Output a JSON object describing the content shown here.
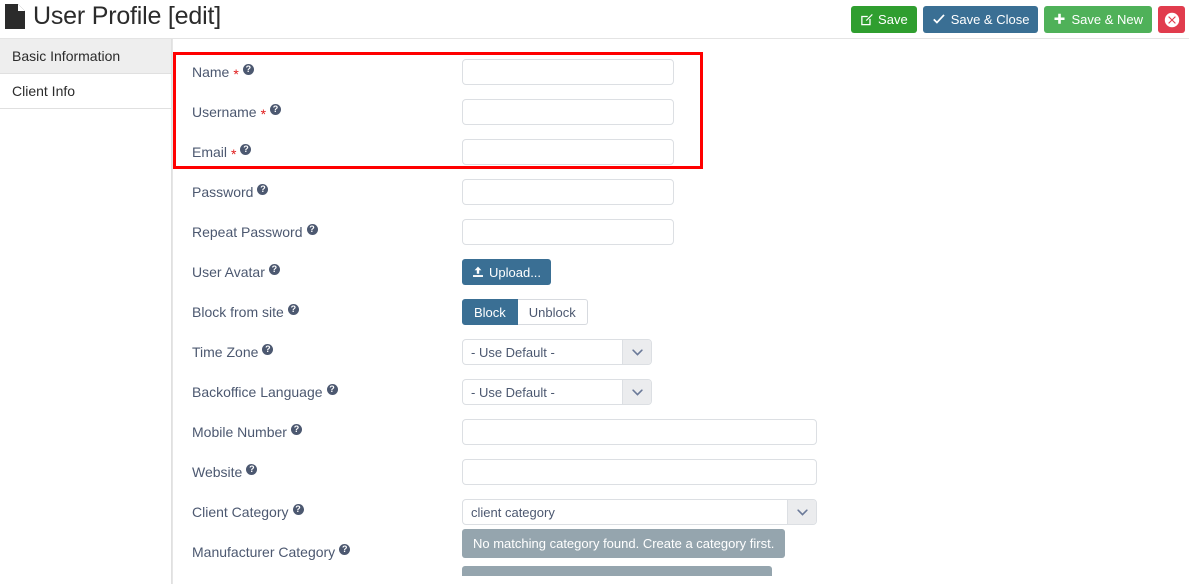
{
  "header": {
    "title": "User Profile [edit]",
    "doc_icon": "document-icon",
    "buttons": {
      "save": {
        "label": "Save",
        "icon": "edit-pencil-icon",
        "color": "#2f9e2f"
      },
      "save_close": {
        "label": "Save & Close",
        "icon": "check-icon",
        "color": "#3a6f94"
      },
      "save_new": {
        "label": "Save & New",
        "icon": "plus-icon",
        "color": "#4fb159"
      },
      "close": {
        "label": "",
        "icon": "close-circle-icon",
        "color": "#e13c4d"
      }
    }
  },
  "sidebar": {
    "items": [
      {
        "label": "Basic Information",
        "active": true
      },
      {
        "label": "Client Info",
        "active": false
      }
    ]
  },
  "form": {
    "highlight": {
      "color": "#ff0000",
      "fields": [
        "Name",
        "Username",
        "Email"
      ]
    },
    "help_icon": "question-mark-icon",
    "required_marker": "*",
    "fields": [
      {
        "label": "Name",
        "required": true,
        "type": "text",
        "value": "",
        "width": "narrow"
      },
      {
        "label": "Username",
        "required": true,
        "type": "text",
        "value": "",
        "width": "narrow"
      },
      {
        "label": "Email",
        "required": true,
        "type": "text",
        "value": "",
        "width": "narrow"
      },
      {
        "label": "Password",
        "required": false,
        "type": "text",
        "value": "",
        "width": "narrow"
      },
      {
        "label": "Repeat Password",
        "required": false,
        "type": "text",
        "value": "",
        "width": "narrow"
      },
      {
        "label": "User Avatar",
        "required": false,
        "type": "upload",
        "button_label": "Upload...",
        "icon": "upload-icon"
      },
      {
        "label": "Block from site",
        "required": false,
        "type": "toggle",
        "options": [
          "Block",
          "Unblock"
        ],
        "selected": "Block"
      },
      {
        "label": "Time Zone",
        "required": false,
        "type": "select",
        "value": "- Use Default -",
        "width": "narrow"
      },
      {
        "label": "Backoffice Language",
        "required": false,
        "type": "select",
        "value": "- Use Default -",
        "width": "narrow"
      },
      {
        "label": "Mobile Number",
        "required": false,
        "type": "text",
        "value": "",
        "width": "wide"
      },
      {
        "label": "Website",
        "required": false,
        "type": "text",
        "value": "",
        "width": "wide"
      },
      {
        "label": "Client Category",
        "required": false,
        "type": "select",
        "value": "client category",
        "width": "wide"
      },
      {
        "label": "Manufacturer Category",
        "required": false,
        "type": "notice",
        "notice": "No matching category found. Create a category first."
      }
    ]
  }
}
